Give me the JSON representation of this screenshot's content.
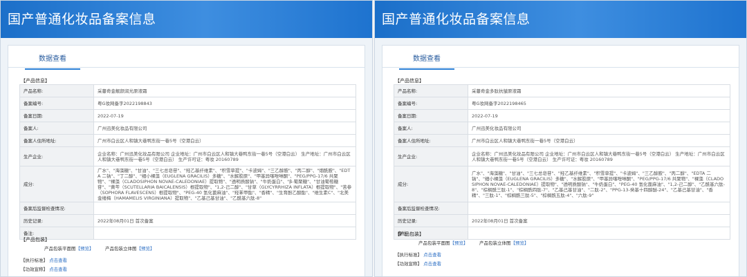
{
  "panels": [
    {
      "banner_title": "国产普通化妆品备案信息",
      "tab_label": "数据查看",
      "section_product_info": "【产品信息】",
      "fields": [
        {
          "label": "产品名称:",
          "value": "采蔓奇金靓颜润光原液霜"
        },
        {
          "label": "备案编号:",
          "value": "粤G妆网备字2022198843"
        },
        {
          "label": "备案日期:",
          "value": "2022-07-19"
        },
        {
          "label": "备案人:",
          "value": "广州迅美化妆品有限公司"
        },
        {
          "label": "备案人住所地址:",
          "value": "广州市白云区人和镇大巷鸭东街一巷5号（空港白云）"
        },
        {
          "label": "生产企业:",
          "value": "企业名称：广州迅美化妆品有限公司 企业地址：广州市白云区人和镇大巷鸭东街一巷5号（空港白云） 生产地址：广州市白云区人和镇大巷鸭东街一巷5号（空港白云） 生产许可证：粤妆 20160789"
        },
        {
          "label": "成分:",
          "value": "广水\"、\"海藻糖\"、\"甘油\"、\"三七总皂苷\"、\"羟乙基纤维素\"、\"积雪草提\"、\"卡波姆\"、\"三乙醇胺\"、\"丙二醇\"、\"烟酰胺\"、\"EDTA 二钠\"、\"丁二醇\"、\"细小裸藻（EUGLENA GRACILIS）多糖\"、\"水解胶原\"、\"甲基异噻唑啉酮\"、\"PEG/PPG-17/6 共聚物\"、\"裸藻（CLADOSIPHON NOVAE-CALEDONIAE）提取物\"、\"透明质酸钠\"、\"牛奶蛋白\"、\"β-葡聚糖\"、\"甘油葡萄糖苷\"、\"黄芩（SCUTELLARIA BAICALENSIS）根提取物\"、\"1,2-己二醇\"、\"甘草（GLYCYRRHIZA INFLATA）根提取物\"、\"苦参（SOPHORA FLAVESCENS）根提取物\"、\"PEG-40 氢化蓖麻油\"、\"羟苯甲酯\"、\"香精\"、\"生育酚乙酸酯\"、\"维生素C\"、\"北美金缕梅（HAMAMELIS VIRGINIANA）提取物\"、\"乙基己基甘油\"、\"乙酰基六肽-8\""
        },
        {
          "label": "备案后监督检查情况:",
          "value": ""
        },
        {
          "label": "历史记录:",
          "value": "2022年08月01日 首次备案"
        },
        {
          "label": "备注:",
          "value": ""
        }
      ],
      "section_packaging": "【产品包装】",
      "pack_flat_label": "产品包装平面图",
      "pack_3d_label": "产品包装立体图",
      "preview_link": "【预览】",
      "section_standard": "【执行标准】",
      "section_efficacy": "【功效宣称】",
      "view_link": "点击查看"
    },
    {
      "banner_title": "国产普通化妆品备案信息",
      "tab_label": "数据查看",
      "section_product_info": "【产品信息】",
      "fields": [
        {
          "label": "产品名称:",
          "value": "采蔓奇金多肽抗皱原液霜"
        },
        {
          "label": "备案编号:",
          "value": "粤G妆网备字2022198465"
        },
        {
          "label": "备案日期:",
          "value": "2022-07-19"
        },
        {
          "label": "备案人:",
          "value": "广州迅美化妆品有限公司"
        },
        {
          "label": "备案人住所地址:",
          "value": "广州市白云区人和镇大巷鸭东街一巷5号（空港白云）"
        },
        {
          "label": "生产企业:",
          "value": "企业名称：广州迅美化妆品有限公司 企业地址：广州市白云区人和镇大巷鸭东街一巷5号（空港白云） 生产地址：广州市白云区人和镇大巷鸭东街一巷5号（空港白云） 生产许可证：粤妆 20160789"
        },
        {
          "label": "成分:",
          "value": "广水\"、\"海藻糖\"、\"甘油\"、\"三七总皂苷\"、\"羟乙基纤维素\"、\"积雪草提\"、\"卡波姆\"、\"三乙醇胺\"、\"丙二醇\"、\"EDTA 二钠\"、\"细小裸藻（EUGLENA GRACILIS）多糖\"、\"水解胶原\"、\"甲基异噻唑啉酮\"、\"PEG/PPG-17/6 共聚物\"、\"裸藻（CLADOSIPHON NOVAE-CALEDONIAE）提取物\"、\"透明质酸钠\"、\"牛奶蛋白\"、\"PEG-40 氢化蓖麻油\"、\"1,2-己二醇\"、\"乙酰基六肽-8\"、\"棕榈酰三肽-1\"、\"棕榈酰四肽-7\"、\"乙基己基甘油\"、\"二肽-2\"、\"PPG-13-癸基十四醇醚-24\"、\"乙基己基甘油\"、\"香精\"、\"三肽-1\"、\"棕榈酰三肽-5\"、\"棕榈酰五肽-4\"、\"六肽-9\""
        },
        {
          "label": "备案后监督检查情况:",
          "value": ""
        },
        {
          "label": "历史记录:",
          "value": "2022年08月01日 首次备案"
        },
        {
          "label": "备注:",
          "value": ""
        }
      ],
      "section_packaging": "【产品包装】",
      "pack_flat_label": "产品包装平面图",
      "pack_3d_label": "产品包装立体图",
      "preview_link": "【预览】",
      "section_standard": "【执行标准】",
      "section_efficacy": "【功效宣称】",
      "view_link": "点击查看"
    }
  ]
}
